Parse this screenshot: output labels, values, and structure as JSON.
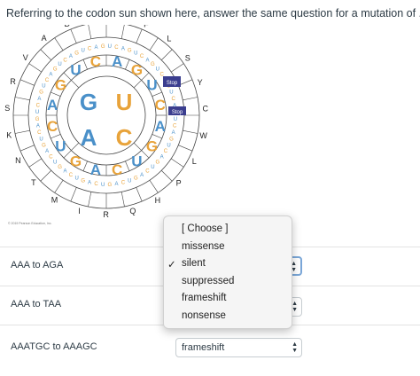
{
  "question": {
    "text": "Referring to the codon sun shown here, answer the same question for a mutation of ..."
  },
  "copyright": "© 2019 Pearson Education, Inc.",
  "wheel": {
    "inner_bases": [
      "G",
      "U",
      "A",
      "C"
    ],
    "ring2_bases": [
      "A",
      "G",
      "U",
      "C",
      "A",
      "G",
      "U",
      "C",
      "A",
      "G",
      "U",
      "C",
      "A",
      "G",
      "U",
      "C"
    ],
    "amino_labels": [
      "G",
      "F",
      "L",
      "S",
      "Y",
      "C",
      "W",
      "L",
      "P",
      "H",
      "Q",
      "R",
      "I",
      "M",
      "T",
      "N",
      "K",
      "S",
      "R",
      "V",
      "A",
      "D",
      "E"
    ],
    "stop_labels": [
      "Stop",
      "Stop"
    ]
  },
  "rows": [
    {
      "label": "AAA to AGA",
      "value": ""
    },
    {
      "label": "AAA to TAA",
      "value": ""
    },
    {
      "label": "AAATGC to AAAGC",
      "value": "frameshift"
    }
  ],
  "dropdown": {
    "options": [
      "[ Choose ]",
      "missense",
      "silent",
      "suppressed",
      "frameshift",
      "nonsense"
    ],
    "checked_index": 2,
    "check_glyph": "✓"
  }
}
